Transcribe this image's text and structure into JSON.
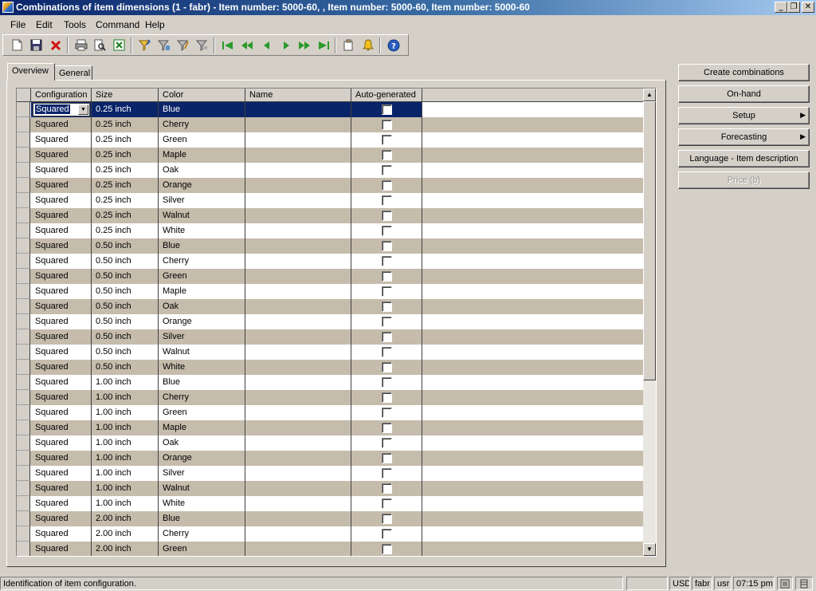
{
  "window": {
    "title": "Combinations of item dimensions (1 - fabr) - Item number: 5000-60, , Item number: 5000-60, Item number: 5000-60",
    "minimize": "_",
    "restore": "❐",
    "close": "✕"
  },
  "menu": {
    "file": "File",
    "edit": "Edit",
    "tools": "Tools",
    "command": "Command",
    "help": "Help"
  },
  "toolbar": {
    "icons": [
      "new-icon",
      "save-icon",
      "delete-icon",
      "print-icon",
      "print-preview-icon",
      "export-excel-icon",
      "filter-by-selection-icon",
      "advanced-filter-icon",
      "filter-by-field-icon",
      "remove-filter-icon",
      "first-record-icon",
      "previous-page-icon",
      "previous-record-icon",
      "next-record-icon",
      "next-page-icon",
      "last-record-icon",
      "document-handling-icon",
      "alert-icon",
      "help-icon"
    ]
  },
  "tabs": {
    "overview": "Overview",
    "general": "General"
  },
  "grid": {
    "columns": [
      "Configuration",
      "Size",
      "Color",
      "Name",
      "Auto-generated"
    ],
    "selected_row": 0,
    "rows": [
      {
        "configuration": "Squared",
        "size": "0.25 inch",
        "color": "Blue",
        "name": "",
        "auto": false
      },
      {
        "configuration": "Squared",
        "size": "0.25 inch",
        "color": "Cherry",
        "name": "",
        "auto": false
      },
      {
        "configuration": "Squared",
        "size": "0.25 inch",
        "color": "Green",
        "name": "",
        "auto": false
      },
      {
        "configuration": "Squared",
        "size": "0.25 inch",
        "color": "Maple",
        "name": "",
        "auto": false
      },
      {
        "configuration": "Squared",
        "size": "0.25 inch",
        "color": "Oak",
        "name": "",
        "auto": false
      },
      {
        "configuration": "Squared",
        "size": "0.25 inch",
        "color": "Orange",
        "name": "",
        "auto": false
      },
      {
        "configuration": "Squared",
        "size": "0.25 inch",
        "color": "Silver",
        "name": "",
        "auto": false
      },
      {
        "configuration": "Squared",
        "size": "0.25 inch",
        "color": "Walnut",
        "name": "",
        "auto": false
      },
      {
        "configuration": "Squared",
        "size": "0.25 inch",
        "color": "White",
        "name": "",
        "auto": false
      },
      {
        "configuration": "Squared",
        "size": "0.50 inch",
        "color": "Blue",
        "name": "",
        "auto": false
      },
      {
        "configuration": "Squared",
        "size": "0.50 inch",
        "color": "Cherry",
        "name": "",
        "auto": false
      },
      {
        "configuration": "Squared",
        "size": "0.50 inch",
        "color": "Green",
        "name": "",
        "auto": false
      },
      {
        "configuration": "Squared",
        "size": "0.50 inch",
        "color": "Maple",
        "name": "",
        "auto": false
      },
      {
        "configuration": "Squared",
        "size": "0.50 inch",
        "color": "Oak",
        "name": "",
        "auto": false
      },
      {
        "configuration": "Squared",
        "size": "0.50 inch",
        "color": "Orange",
        "name": "",
        "auto": false
      },
      {
        "configuration": "Squared",
        "size": "0.50 inch",
        "color": "Silver",
        "name": "",
        "auto": false
      },
      {
        "configuration": "Squared",
        "size": "0.50 inch",
        "color": "Walnut",
        "name": "",
        "auto": false
      },
      {
        "configuration": "Squared",
        "size": "0.50 inch",
        "color": "White",
        "name": "",
        "auto": false
      },
      {
        "configuration": "Squared",
        "size": "1.00 inch",
        "color": "Blue",
        "name": "",
        "auto": false
      },
      {
        "configuration": "Squared",
        "size": "1.00 inch",
        "color": "Cherry",
        "name": "",
        "auto": false
      },
      {
        "configuration": "Squared",
        "size": "1.00 inch",
        "color": "Green",
        "name": "",
        "auto": false
      },
      {
        "configuration": "Squared",
        "size": "1.00 inch",
        "color": "Maple",
        "name": "",
        "auto": false
      },
      {
        "configuration": "Squared",
        "size": "1.00 inch",
        "color": "Oak",
        "name": "",
        "auto": false
      },
      {
        "configuration": "Squared",
        "size": "1.00 inch",
        "color": "Orange",
        "name": "",
        "auto": false
      },
      {
        "configuration": "Squared",
        "size": "1.00 inch",
        "color": "Silver",
        "name": "",
        "auto": false
      },
      {
        "configuration": "Squared",
        "size": "1.00 inch",
        "color": "Walnut",
        "name": "",
        "auto": false
      },
      {
        "configuration": "Squared",
        "size": "1.00 inch",
        "color": "White",
        "name": "",
        "auto": false
      },
      {
        "configuration": "Squared",
        "size": "2.00 inch",
        "color": "Blue",
        "name": "",
        "auto": false
      },
      {
        "configuration": "Squared",
        "size": "2.00 inch",
        "color": "Cherry",
        "name": "",
        "auto": false
      },
      {
        "configuration": "Squared",
        "size": "2.00 inch",
        "color": "Green",
        "name": "",
        "auto": false
      }
    ]
  },
  "side_buttons": {
    "create_combinations": "Create combinations",
    "on_hand": "On-hand",
    "setup": "Setup",
    "forecasting": "Forecasting",
    "language_item_description": "Language - Item description",
    "price": "Price (b)"
  },
  "status": {
    "message": "Identification of item configuration.",
    "currency": "USD",
    "company": "fabr",
    "user": "usr",
    "time": "07:15 pm"
  },
  "colors": {
    "title_start": "#0a246a",
    "selection": "#0a246a",
    "row_alt": "#c6bcac",
    "chrome": "#d4d0c8"
  }
}
